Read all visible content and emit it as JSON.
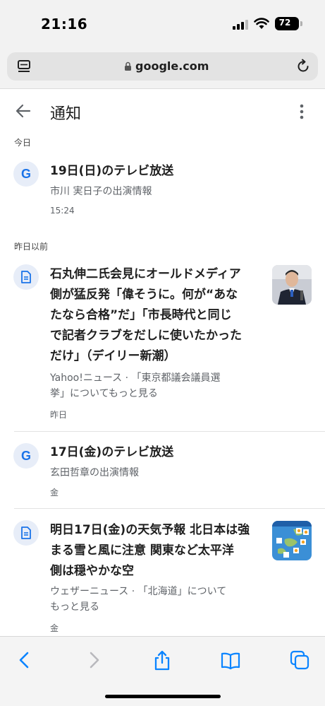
{
  "status_bar": {
    "time": "21:16",
    "battery": "72"
  },
  "browser": {
    "url": "google.com"
  },
  "header": {
    "title": "通知"
  },
  "sections": {
    "today": "今日",
    "earlier": "昨日以前"
  },
  "notifications": [
    {
      "title_lines": [
        "19日(日)のテレビ放送"
      ],
      "sub_lines": [
        "市川 実日子の出演情報"
      ],
      "time": "15:24",
      "icon": "google-g-icon"
    },
    {
      "title_lines": [
        "石丸伸二氏会見にオールドメディア",
        "側が猛反発「偉そうに。何が“あな",
        "たなら合格”だ」「市長時代と同じ",
        "で記者クラブをだしに使いたかった",
        "だけ」（デイリー新潮）"
      ],
      "sub_lines": [
        "Yahoo!ニュース · 「東京都議会議員選",
        "挙」についてもっと見る"
      ],
      "time": "昨日",
      "icon": "article-icon"
    },
    {
      "title_lines": [
        "17日(金)のテレビ放送"
      ],
      "sub_lines": [
        "玄田哲章の出演情報"
      ],
      "time": "金",
      "icon": "google-g-icon"
    },
    {
      "title_lines": [
        "明日17日(金)の天気予報 北日本は強",
        "まる雪と風に注意 関東など太平洋",
        "側は穏やかな空"
      ],
      "sub_lines": [
        "ウェザーニュース · 「北海道」について",
        "もっと見る"
      ],
      "time": "金",
      "icon": "article-icon"
    }
  ],
  "colors": {
    "accent": "#1a73e8",
    "safari_blue": "#0a84ff",
    "icon_bg": "#e7edf8"
  }
}
